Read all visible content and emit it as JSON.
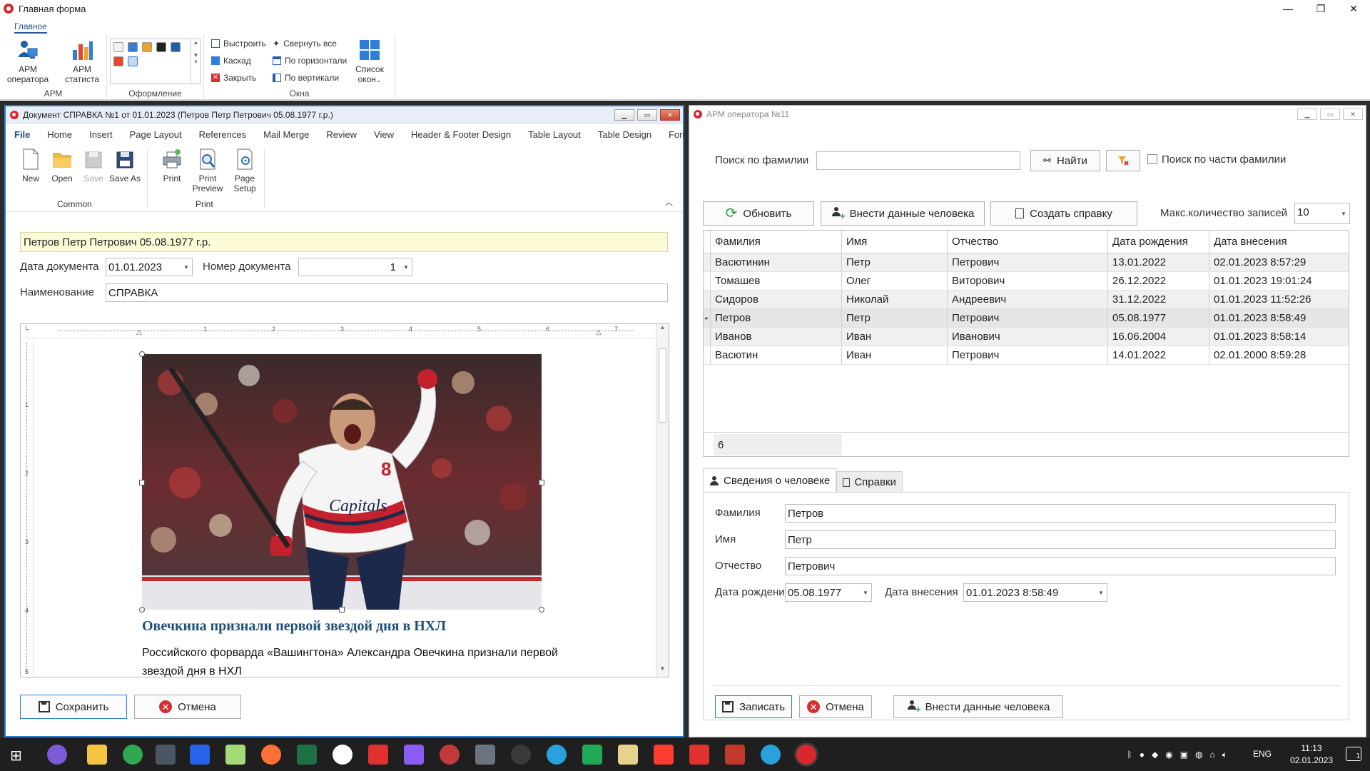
{
  "main_window": {
    "title": "Главная форма",
    "ribbon_tab": "Главное",
    "groups": {
      "arm": {
        "label": "АРМ",
        "operator": "АРМ оператора",
        "statistics": "АРМ статиста"
      },
      "design": {
        "label": "Оформление"
      },
      "windows": {
        "label": "Окна",
        "arrange": "Выстроить",
        "cascade": "Каскад",
        "close": "Закрыть",
        "collapse_all": "Свернуть все",
        "horizontal": "По горизонтали",
        "vertical": "По вертикали",
        "window_list": "Список окон"
      }
    }
  },
  "doc_window": {
    "title": "Документ СПРАВКА №1 от 01.01.2023 (Петров Петр Петрович 05.08.1977 г.р.)",
    "tabs": [
      "File",
      "Home",
      "Insert",
      "Page Layout",
      "References",
      "Mail Merge",
      "Review",
      "View",
      "Header & Footer Design",
      "Table Layout",
      "Table Design",
      "Format"
    ],
    "buttons": {
      "new": "New",
      "open": "Open",
      "save": "Save",
      "save_as": "Save As",
      "print": "Print",
      "print_preview": "Print Preview",
      "page_setup": "Page Setup"
    },
    "group_common": "Common",
    "group_print": "Print",
    "person": "Петров Петр Петрович 05.08.1977 г.р.",
    "doc_date_label": "Дата документа",
    "doc_date": "01.01.2023",
    "doc_number_label": "Номер документа",
    "doc_number": "1",
    "name_label": "Наименование",
    "name": "СПРАВКА",
    "ruler_numbers": [
      "1",
      "2",
      "3",
      "4",
      "5",
      "6",
      "7"
    ],
    "vruler_numbers": [
      "1",
      "2",
      "3",
      "4",
      "5"
    ],
    "article_title": "Овечкина признали первой звездой дня в НХЛ",
    "article_body": "Российского форварда «Вашингтона» Александра Овечкина признали первой звездой дня в НХЛ",
    "save_button": "Сохранить",
    "cancel_button": "Отмена"
  },
  "operator_window": {
    "title": "АРМ оператора №11",
    "search_label": "Поиск по фамилии",
    "search_value": "",
    "find_button": "Найти",
    "partial_search_label": "Поиск по части фамилии",
    "refresh_button": "Обновить",
    "add_person_button": "Внести данные человека",
    "create_cert_button": "Создать справку",
    "max_records_label": "Макс.количество записей",
    "max_records_value": "10",
    "columns": [
      "Фамилия",
      "Имя",
      "Отчество",
      "Дата рождения",
      "Дата внесения"
    ],
    "rows": [
      [
        "Васютинин",
        "Петр",
        "Петрович",
        "13.01.2022",
        "02.01.2023 8:57:29"
      ],
      [
        "Томашев",
        "Олег",
        "Виторович",
        "26.12.2022",
        "01.01.2023 19:01:24"
      ],
      [
        "Сидоров",
        "Николай",
        "Андреевич",
        "31.12.2022",
        "01.01.2023 11:52:26"
      ],
      [
        "Петров",
        "Петр",
        "Петрович",
        "05.08.1977",
        "01.01.2023 8:58:49"
      ],
      [
        "Иванов",
        "Иван",
        "Иванович",
        "16.06.2004",
        "01.01.2023 8:58:14"
      ],
      [
        "Васютин",
        "Иван",
        "Петрович",
        "14.01.2022",
        "02.01.2000 8:59:28"
      ]
    ],
    "row_count": "6",
    "tab_person": "Сведения о человеке",
    "tab_certs": "Справки",
    "detail": {
      "surname_label": "Фамилия",
      "surname": "Петров",
      "name_label": "Имя",
      "name": "Петр",
      "patronymic_label": "Отчество",
      "patronymic": "Петрович",
      "birth_label": "Дата рождения",
      "birth": "05.08.1977",
      "entered_label": "Дата внесения",
      "entered": "01.01.2023 8:58:49"
    },
    "write_button": "Записать",
    "cancel_button": "Отмена",
    "add_person_button2": "Внести данные человека"
  },
  "taskbar": {
    "lang": "ENG",
    "time": "11:13",
    "date": "02.01.2023",
    "notifications": "1"
  },
  "colors": {
    "accent": "#2d7bd1",
    "person_highlight": "#fdfbd7",
    "article_title": "#1f4e79",
    "close_red": "#d62f2f"
  }
}
